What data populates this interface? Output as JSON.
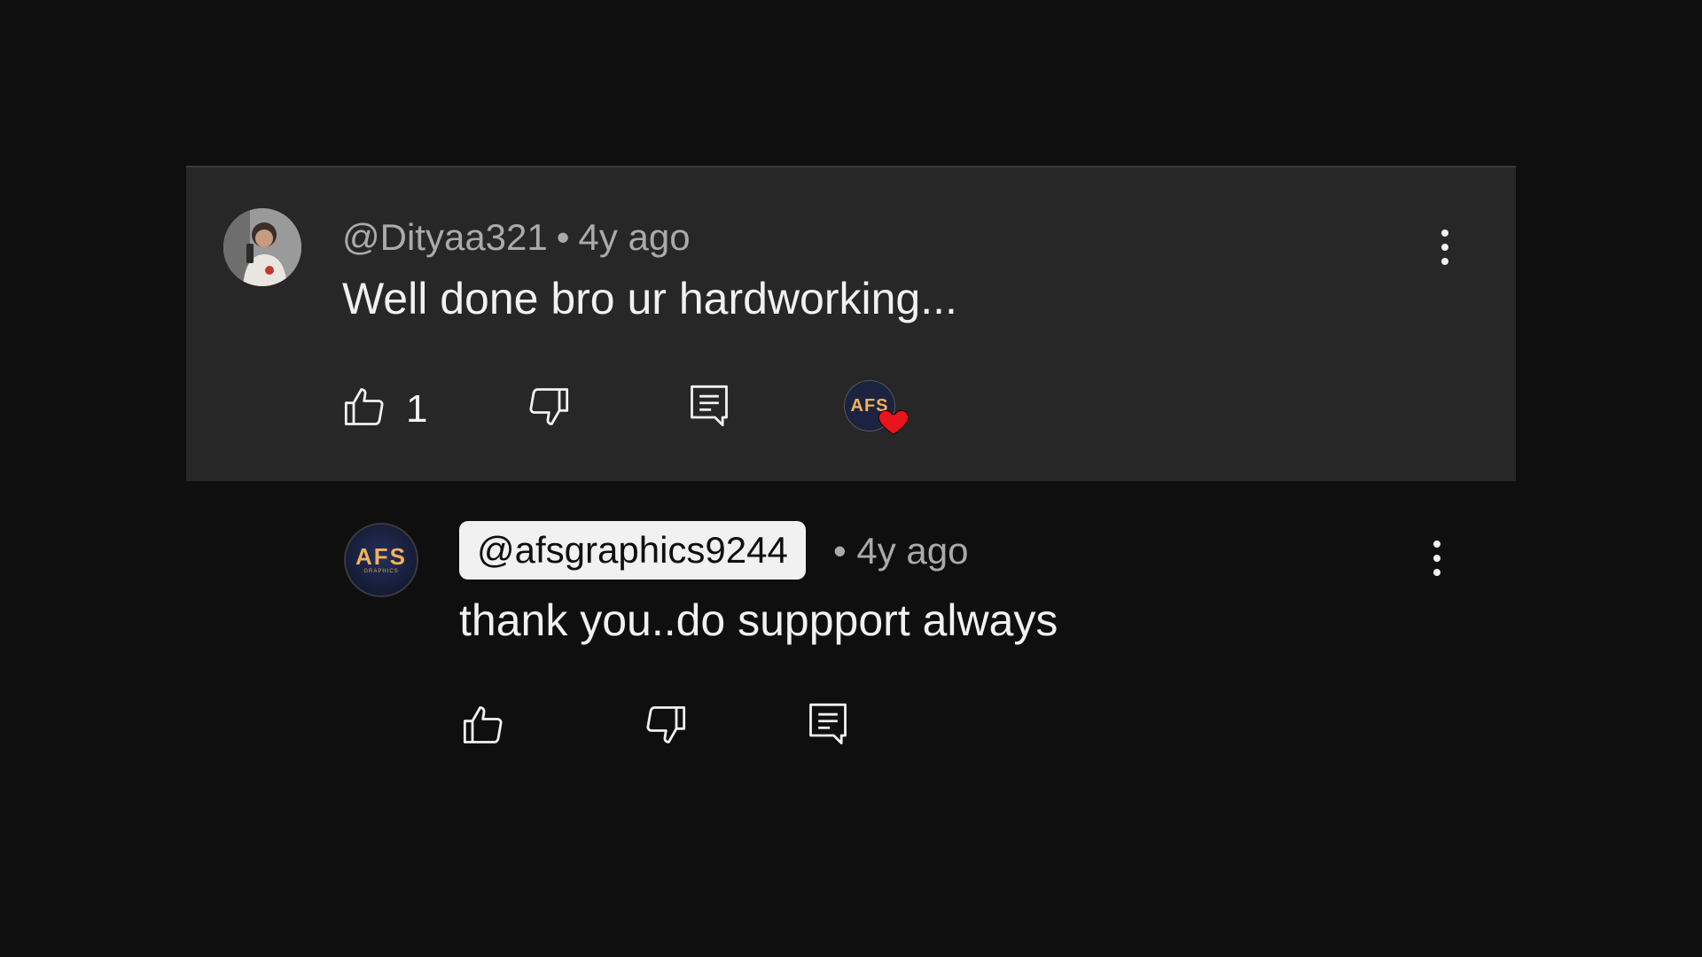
{
  "comment": {
    "author": "@Dityaa321",
    "separator": "•",
    "time": "4y ago",
    "text": "Well done bro ur hardworking...",
    "likes": "1",
    "avatar_icon": "user-photo-avatar",
    "hearted_by_icon": "creator-heart-badge",
    "heart_badge_logo": "AFS"
  },
  "reply": {
    "author": "@afsgraphics9244",
    "separator": "•",
    "time": "4y ago",
    "text": "thank you..do suppport always",
    "avatar_logo": "AFS",
    "avatar_logo_sub": "GRAPHICS"
  },
  "colors": {
    "background": "#0f0f0f",
    "highlight_card": "#272727",
    "primary_text": "#f1f1f1",
    "secondary_text": "#aaaaaa",
    "heart": "#e8141e",
    "logo_gold": "#f2b15b"
  }
}
